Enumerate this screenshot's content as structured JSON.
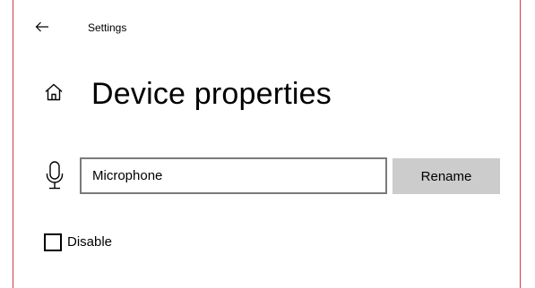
{
  "window": {
    "title": "Settings",
    "accent_border_color": "#d23b47"
  },
  "header": {
    "back_icon": "back-arrow-icon",
    "home_icon": "home-icon",
    "page_title": "Device properties"
  },
  "device": {
    "icon": "microphone-icon",
    "name_value": "Microphone",
    "rename_label": "Rename"
  },
  "disable": {
    "label": "Disable",
    "checked": false
  }
}
